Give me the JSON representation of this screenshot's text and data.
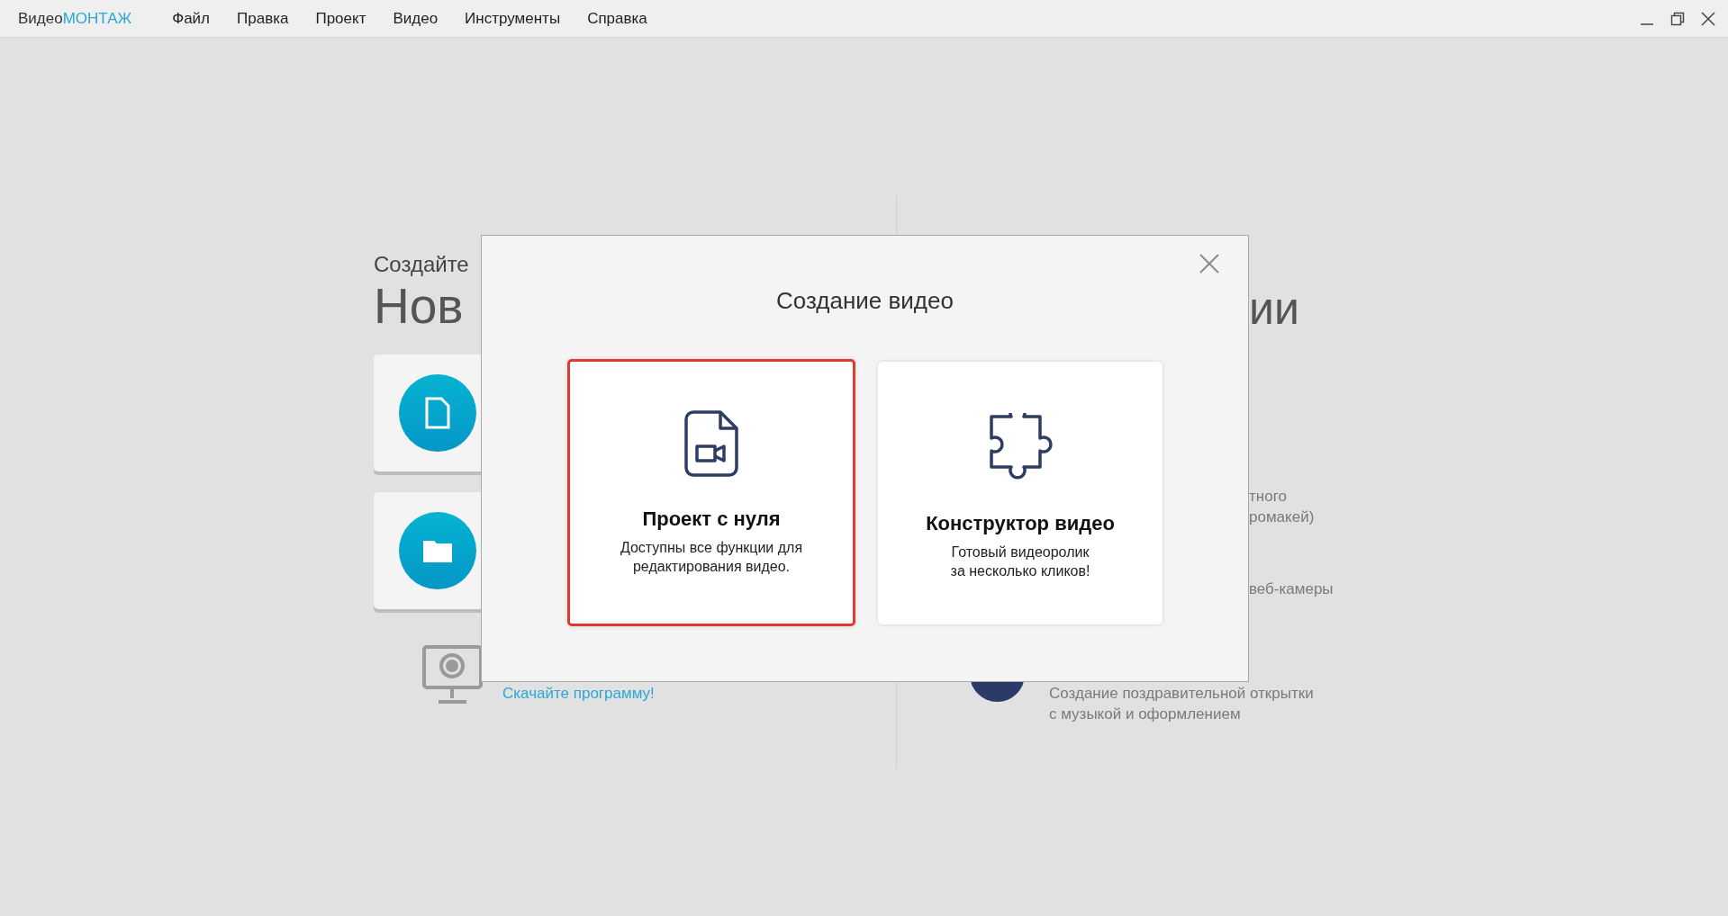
{
  "window": {
    "logo_prefix": "Видео",
    "logo_accent": "МОНТАЖ"
  },
  "menu": [
    "Файл",
    "Правка",
    "Проект",
    "Видео",
    "Инструменты",
    "Справка"
  ],
  "background": {
    "left": {
      "subtitle": "Создайте",
      "heading": "Нов",
      "tiles": [
        {
          "kind": "file"
        },
        {
          "kind": "folder"
        }
      ],
      "link": "Скачайте программу!"
    },
    "right": {
      "heading": "ии",
      "items": [
        {
          "kind": "text",
          "text": "тного\nромакей)"
        },
        {
          "kind": "text",
          "text": "веб-камеры"
        },
        {
          "kind": "icon",
          "text": "Создание поздравительной открытки\nс музыкой и оформлением"
        }
      ]
    }
  },
  "dialog": {
    "title": "Создание видео",
    "options": [
      {
        "kind": "project",
        "title": "Проект с нуля",
        "description": "Доступны все функции для\nредактирования видео.",
        "selected": true
      },
      {
        "kind": "constructor",
        "title": "Конструктор видео",
        "description": "Готовый видеоролик\nза несколько кликов!",
        "selected": false
      }
    ]
  }
}
